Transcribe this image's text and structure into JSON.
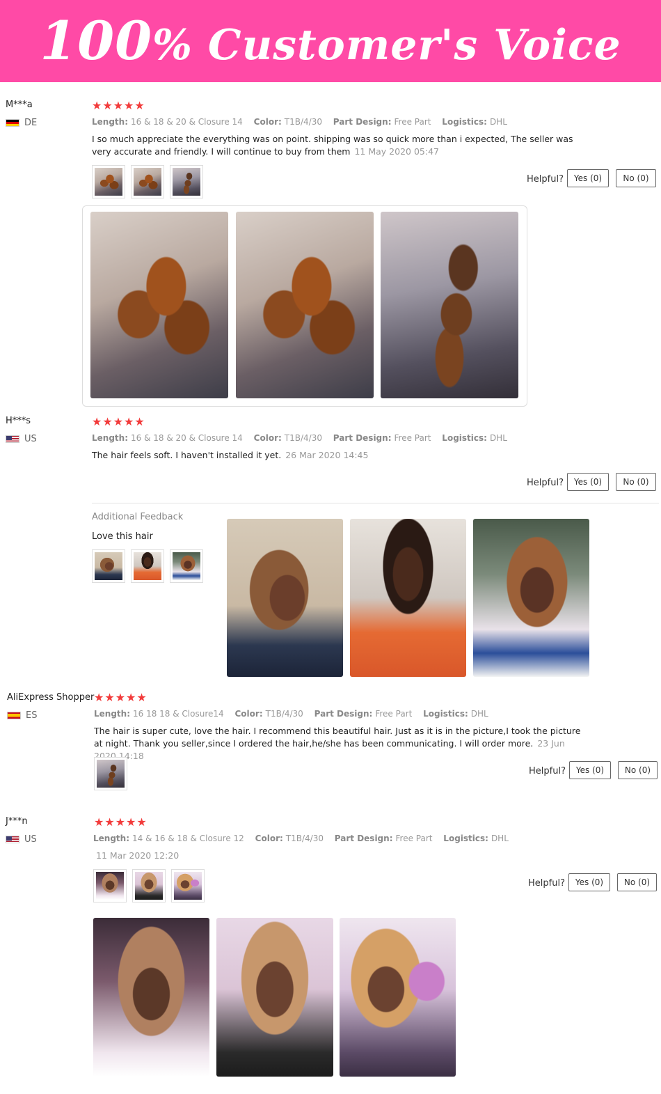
{
  "banner": {
    "number": "100",
    "rest": "% Customer's Voice"
  },
  "reviews": [
    {
      "user": "M***a",
      "country": "DE",
      "stars": "★★★★★",
      "length_k": "Length:",
      "length_v": "16 & 18 & 20 & Closure 14",
      "color_k": "Color:",
      "color_v": "T1B/4/30",
      "part_k": "Part Design:",
      "part_v": "Free Part",
      "log_k": "Logistics:",
      "log_v": "DHL",
      "text": "I so much appreciate the everything was on point. shipping was so quick more than i expected, The seller was very accurate and friendly. I will continue to buy from them",
      "date": "11 May 2020 05:47",
      "helpful": "Helpful?",
      "yes": "Yes (0)",
      "no": "No (0)"
    },
    {
      "user": "H***s",
      "country": "US",
      "stars": "★★★★★",
      "length_k": "Length:",
      "length_v": "16 & 18 & 20 & Closure 14",
      "color_k": "Color:",
      "color_v": "T1B/4/30",
      "part_k": "Part Design:",
      "part_v": "Free Part",
      "log_k": "Logistics:",
      "log_v": "DHL",
      "text": "The hair feels soft. I haven't installed it yet.",
      "date": "26 Mar 2020 14:45",
      "helpful": "Helpful?",
      "yes": "Yes (0)",
      "no": "No (0)",
      "additional_label": "Additional Feedback",
      "additional_text": "Love this hair"
    },
    {
      "user": "AliExpress Shopper",
      "country": "ES",
      "stars": "★★★★★",
      "length_k": "Length:",
      "length_v": "16 18 18 & Closure14",
      "color_k": "Color:",
      "color_v": "T1B/4/30",
      "part_k": "Part Design:",
      "part_v": "Free Part",
      "log_k": "Logistics:",
      "log_v": "DHL",
      "text": "The hair is super cute, love the hair. I recommend this beautiful hair. Just as it is in the picture,I took the picture at night. Thank you seller,since I ordered the hair,he/she has been communicating. I will order more.",
      "date": "23 Jun 2020 14:18",
      "helpful": "Helpful?",
      "yes": "Yes (0)",
      "no": "No (0)"
    },
    {
      "user": "J***n",
      "country": "US",
      "stars": "★★★★★",
      "length_k": "Length:",
      "length_v": "14 & 16 & 18 & Closure 12",
      "color_k": "Color:",
      "color_v": "T1B/4/30",
      "part_k": "Part Design:",
      "part_v": "Free Part",
      "log_k": "Logistics:",
      "log_v": "DHL",
      "date": "11 Mar 2020 12:20",
      "helpful": "Helpful?",
      "yes": "Yes (0)",
      "no": "No (0)"
    }
  ],
  "colors": {
    "banner": "#ff4aa6",
    "stars": "#f23b3b"
  }
}
